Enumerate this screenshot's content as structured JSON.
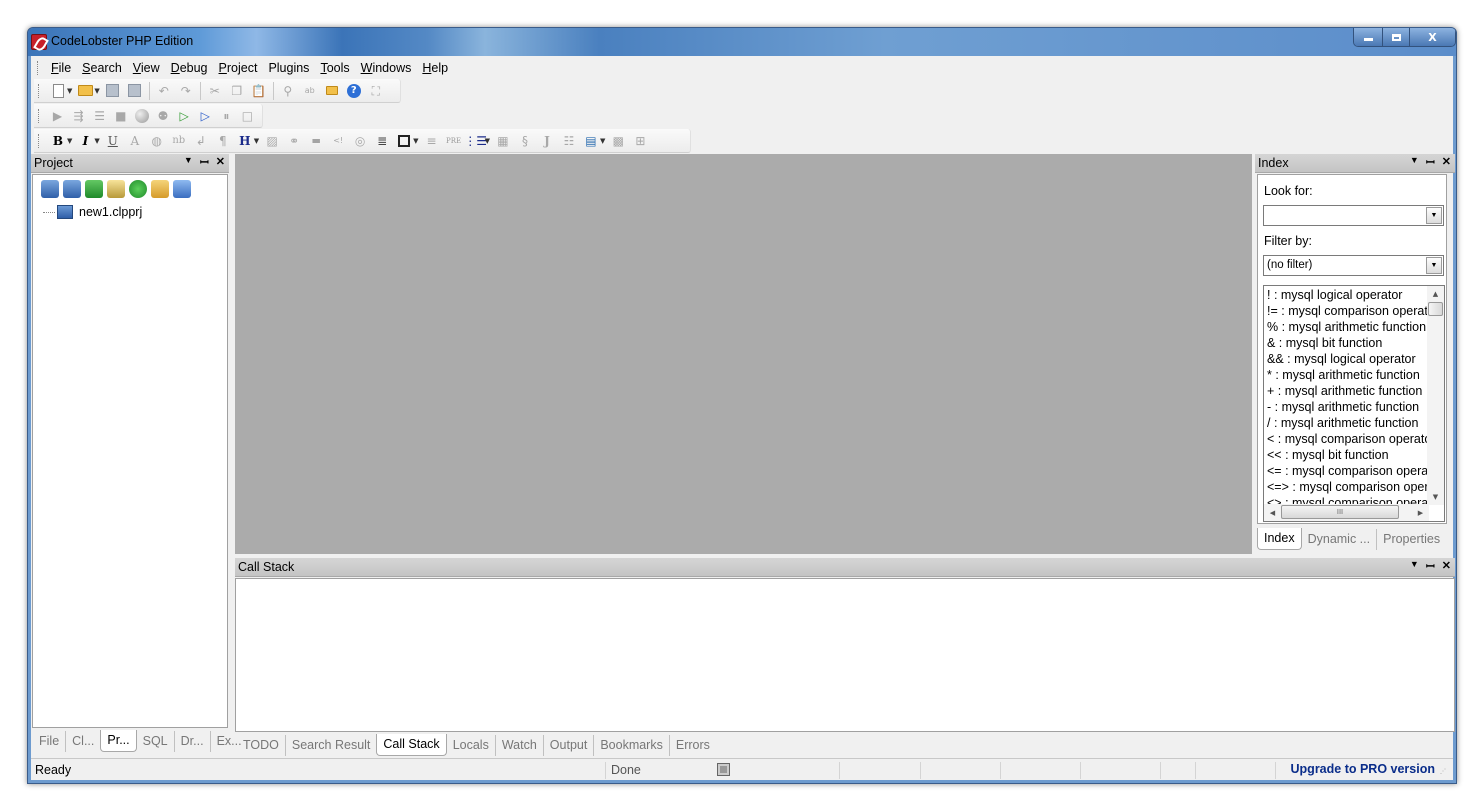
{
  "window": {
    "title": "CodeLobster PHP Edition",
    "controls": {
      "minimize": "—",
      "maximize": "□",
      "close": "X"
    }
  },
  "menu": [
    {
      "label": "File",
      "accel": "F"
    },
    {
      "label": "Search",
      "accel": "S"
    },
    {
      "label": "View",
      "accel": "V"
    },
    {
      "label": "Debug",
      "accel": "D"
    },
    {
      "label": "Project",
      "accel": "P"
    },
    {
      "label": "Plugins",
      "accel": ""
    },
    {
      "label": "Tools",
      "accel": "T"
    },
    {
      "label": "Windows",
      "accel": "W"
    },
    {
      "label": "Help",
      "accel": "H"
    }
  ],
  "toolbars": {
    "standard": [
      "new-file-icon",
      "open-folder-icon",
      "save-icon",
      "save-all-icon",
      "undo-icon",
      "redo-icon",
      "cut-icon",
      "copy-icon",
      "paste-icon",
      "find-icon",
      "replace-icon",
      "find-in-files-icon",
      "help-icon",
      "fullscreen-icon"
    ],
    "debug": [
      "run-icon",
      "step-into-icon",
      "step-over-icon",
      "stop-icon",
      "breakpoint-icon",
      "toggle-breakpoint-icon",
      "start-debug-icon",
      "continue-icon",
      "pause-icon",
      "stop-debug-icon"
    ],
    "html": {
      "bold": "B",
      "italic": "I",
      "underline": "U",
      "font": "A",
      "nbsp": "nb",
      "br": "↲",
      "paragraph": "¶",
      "heading": "H",
      "pre": "PRE",
      "javascript": "J"
    }
  },
  "project_panel": {
    "title": "Project",
    "tree": [
      {
        "label": "new1.clpprj"
      }
    ],
    "tabs": [
      {
        "label": "File",
        "active": false
      },
      {
        "label": "Cl...",
        "active": false
      },
      {
        "label": "Pr...",
        "active": true
      },
      {
        "label": "SQL",
        "active": false
      },
      {
        "label": "Dr...",
        "active": false
      },
      {
        "label": "Ex...",
        "active": false
      }
    ]
  },
  "index_panel": {
    "title": "Index",
    "look_for_label": "Look for:",
    "look_for_value": "",
    "filter_label": "Filter by:",
    "filter_value": "(no filter)",
    "items": [
      "! : mysql logical operator",
      "!= : mysql comparison operator",
      "% : mysql arithmetic function",
      "& : mysql bit function",
      "&& : mysql logical operator",
      "* : mysql arithmetic function",
      "+ : mysql arithmetic function",
      "- : mysql arithmetic function",
      "/ : mysql arithmetic function",
      "< : mysql comparison operator",
      "<< : mysql bit function",
      "<= : mysql comparison operator",
      "<=> : mysql comparison operator",
      "<> : mysql comparison operator"
    ],
    "hscroll_thumb": "III",
    "tabs": [
      {
        "label": "Index",
        "active": true
      },
      {
        "label": "Dynamic ...",
        "active": false
      },
      {
        "label": "Properties",
        "active": false
      }
    ]
  },
  "bottom_panel": {
    "title": "Call Stack",
    "tabs": [
      {
        "label": "TODO",
        "active": false
      },
      {
        "label": "Search Result",
        "active": false
      },
      {
        "label": "Call Stack",
        "active": true
      },
      {
        "label": "Locals",
        "active": false
      },
      {
        "label": "Watch",
        "active": false
      },
      {
        "label": "Output",
        "active": false
      },
      {
        "label": "Bookmarks",
        "active": false
      },
      {
        "label": "Errors",
        "active": false
      }
    ]
  },
  "panel_controls": {
    "dropdown": "▼",
    "pin": "ᛘ",
    "close": "✕"
  },
  "statusbar": {
    "left": "Ready",
    "middle": "Done",
    "upgrade": "Upgrade to PRO version"
  }
}
